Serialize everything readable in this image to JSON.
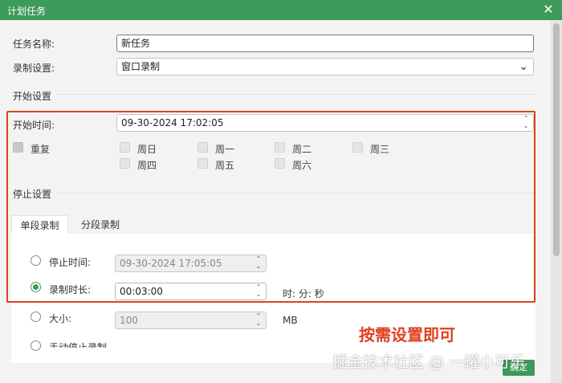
{
  "window": {
    "title": "计划任务",
    "close_icon": "close-icon"
  },
  "task_name": {
    "label": "任务名称:",
    "value": "新任务"
  },
  "record_setting": {
    "label": "录制设置:",
    "selected": "窗口录制"
  },
  "start": {
    "section_title": "开始设置",
    "time_label": "开始时间:",
    "time_value": "09-30-2024 17:02:05",
    "repeat_label": "重复",
    "days": [
      "周日",
      "周一",
      "周二",
      "周三",
      "周四",
      "周五",
      "周六"
    ]
  },
  "stop": {
    "section_title": "停止设置",
    "tabs": [
      "单段录制",
      "分段录制"
    ],
    "stop_time_label": "停止时间:",
    "stop_time_value": "09-30-2024 17:05:05",
    "duration_label": "录制时长:",
    "duration_value": "00:03:00",
    "duration_unit": "时: 分: 秒",
    "size_label": "大小:",
    "size_value": "100",
    "size_unit": "MB",
    "manual_label": "手动停止录制"
  },
  "annotation": "按需设置即可",
  "watermark": "掘金技术社区 @ 一罐小可乐",
  "ok_button": "确定",
  "colors": {
    "accent": "#3d9a5a",
    "highlight": "#e0401f"
  }
}
